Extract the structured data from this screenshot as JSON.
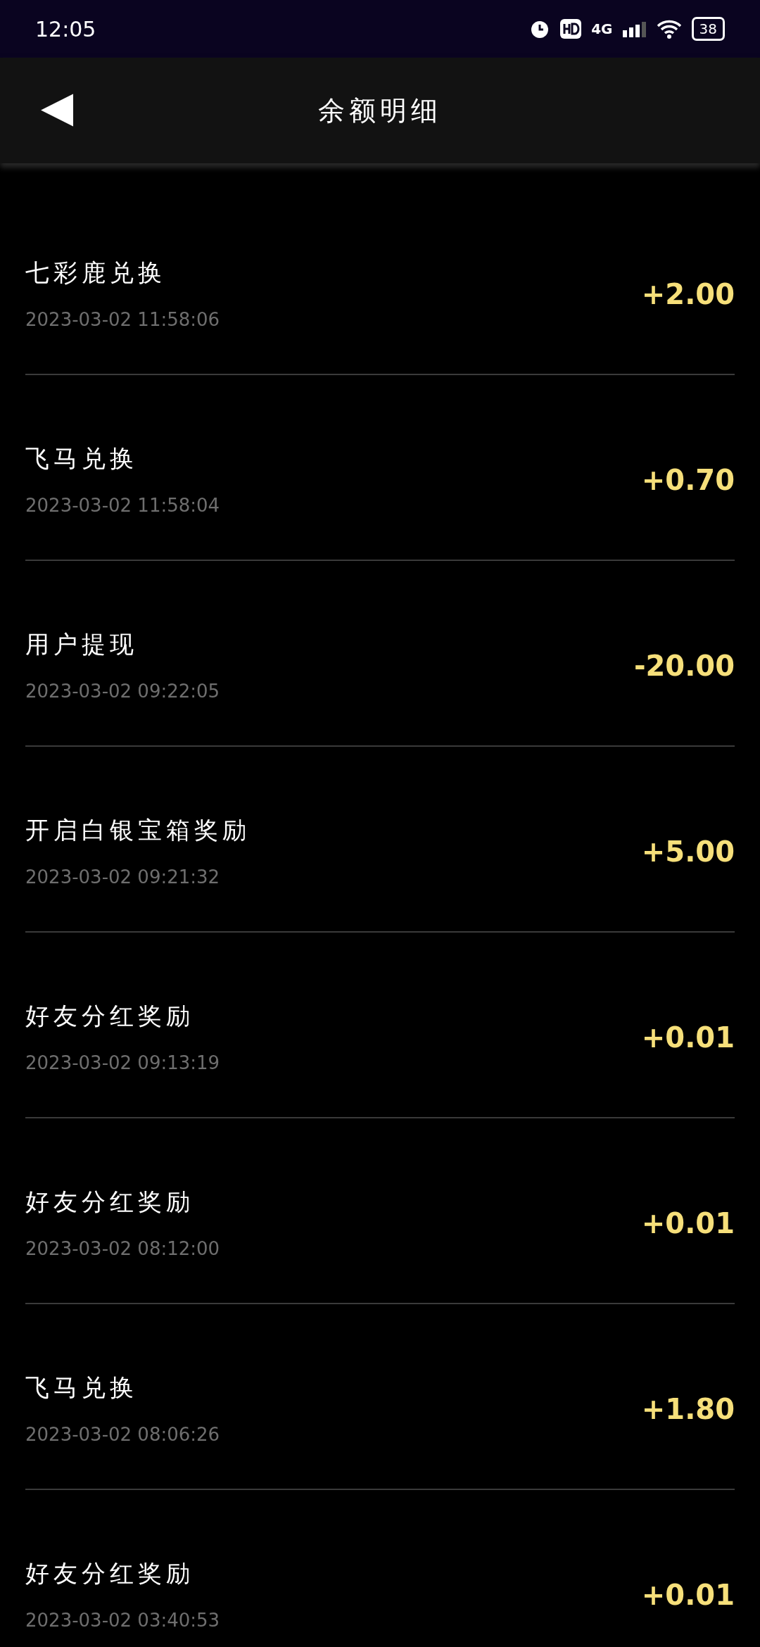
{
  "status_bar": {
    "time": "12:05",
    "network": "4G",
    "battery": "38"
  },
  "header": {
    "back": "◀",
    "title": "余额明细"
  },
  "records": [
    {
      "title": "七彩鹿兑换",
      "time": "2023-03-02 11:58:06",
      "amount": "+2.00"
    },
    {
      "title": "飞马兑换",
      "time": "2023-03-02 11:58:04",
      "amount": "+0.70"
    },
    {
      "title": "用户提现",
      "time": "2023-03-02 09:22:05",
      "amount": "-20.00"
    },
    {
      "title": "开启白银宝箱奖励",
      "time": "2023-03-02 09:21:32",
      "amount": "+5.00"
    },
    {
      "title": "好友分红奖励",
      "time": "2023-03-02 09:13:19",
      "amount": "+0.01"
    },
    {
      "title": "好友分红奖励",
      "time": "2023-03-02 08:12:00",
      "amount": "+0.01"
    },
    {
      "title": "飞马兑换",
      "time": "2023-03-02 08:06:26",
      "amount": "+1.80"
    },
    {
      "title": "好友分红奖励",
      "time": "2023-03-02 03:40:53",
      "amount": "+0.01"
    }
  ]
}
